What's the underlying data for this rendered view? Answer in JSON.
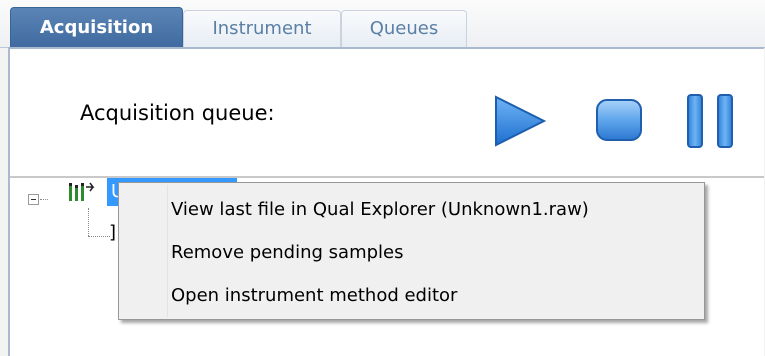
{
  "tabs": [
    {
      "label": "Acquisition",
      "active": true
    },
    {
      "label": "Instrument",
      "active": false
    },
    {
      "label": "Queues",
      "active": false
    }
  ],
  "header": {
    "queue_label": "Acquisition queue:"
  },
  "controls": {
    "play_icon": "play-icon",
    "stop_icon": "stop-icon",
    "pause_icon": "pause-icon",
    "accent_color": "#3b8de0"
  },
  "tree": {
    "root_label": "U",
    "child_label": "]"
  },
  "context_menu": {
    "items": [
      {
        "label": "View last file in Qual Explorer (Unknown1.raw)"
      },
      {
        "label": "Remove pending samples"
      },
      {
        "label": "Open instrument method editor"
      }
    ]
  },
  "colors": {
    "active_tab": "#4a76aa",
    "selection": "#3399ff"
  }
}
